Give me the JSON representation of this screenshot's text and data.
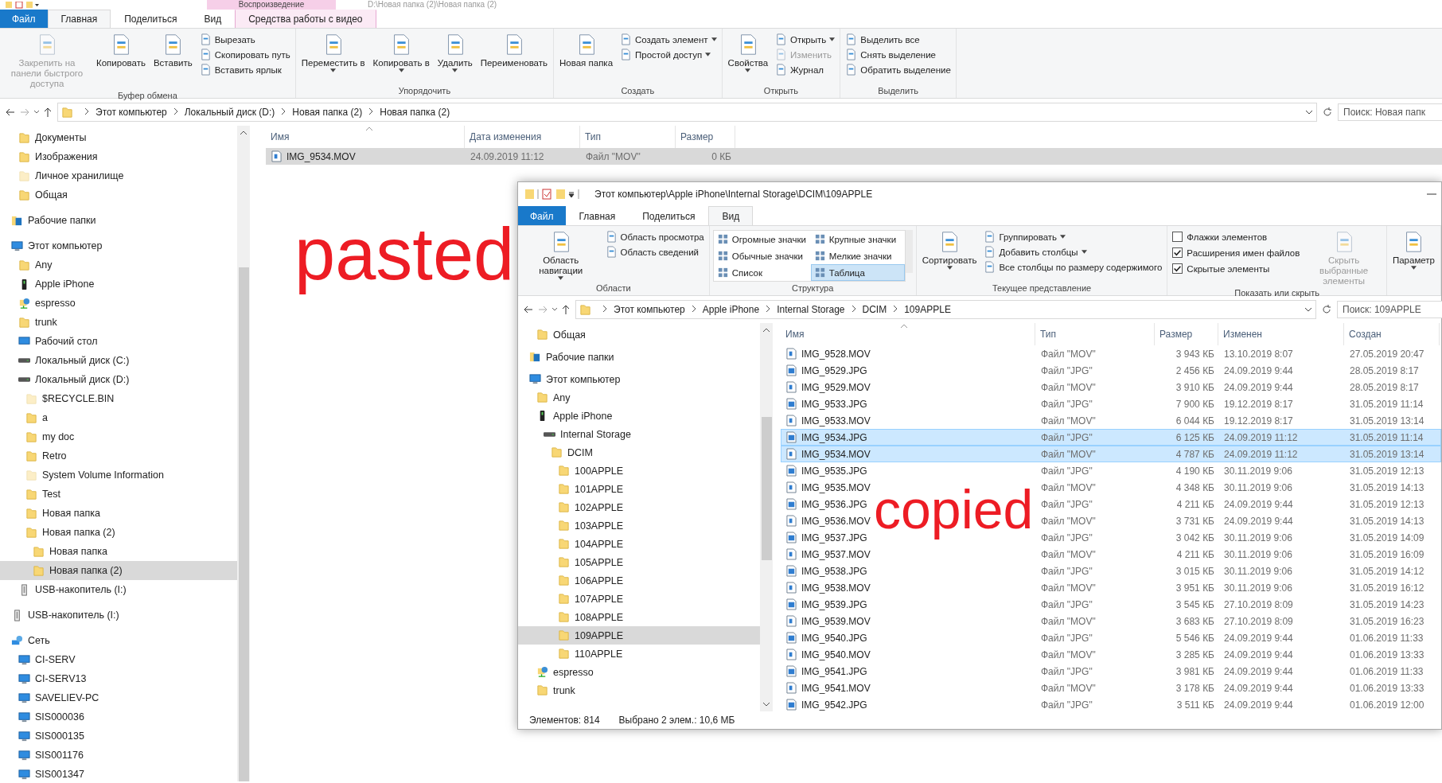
{
  "back_window": {
    "title": "D:\\Новая папка (2)\\Новая папка (2)",
    "context_group": "Воспроизведение",
    "tabs": [
      {
        "label": "Файл",
        "kind": "file",
        "selected": false
      },
      {
        "label": "Главная",
        "kind": "tab",
        "selected": true
      },
      {
        "label": "Поделиться",
        "kind": "tab",
        "selected": false
      },
      {
        "label": "Вид",
        "kind": "tab",
        "selected": false
      },
      {
        "label": "Средства работы с видео",
        "kind": "context",
        "selected": false
      }
    ],
    "ribbon": [
      {
        "label": "Буфер обмена",
        "items": [
          {
            "kind": "large",
            "label": "Закрепить на панели быстрого доступа",
            "dropdown": false,
            "disabled": true
          },
          {
            "kind": "large",
            "label": "Копировать",
            "dropdown": false,
            "disabled": false
          },
          {
            "kind": "large",
            "label": "Вставить",
            "dropdown": false,
            "disabled": false
          },
          {
            "kind": "small",
            "label": "Вырезать",
            "dropdown": false,
            "disabled": false
          },
          {
            "kind": "small",
            "label": "Скопировать путь",
            "dropdown": false,
            "disabled": false
          },
          {
            "kind": "small",
            "label": "Вставить ярлык",
            "dropdown": false,
            "disabled": false
          }
        ]
      },
      {
        "label": "Упорядочить",
        "items": [
          {
            "kind": "large",
            "label": "Переместить в",
            "dropdown": true,
            "disabled": false
          },
          {
            "kind": "large",
            "label": "Копировать в",
            "dropdown": true,
            "disabled": false
          },
          {
            "kind": "large",
            "label": "Удалить",
            "dropdown": true,
            "disabled": false
          },
          {
            "kind": "large",
            "label": "Переименовать",
            "dropdown": false,
            "disabled": false
          }
        ]
      },
      {
        "label": "Создать",
        "items": [
          {
            "kind": "large",
            "label": "Новая папка",
            "dropdown": false,
            "disabled": false
          },
          {
            "kind": "small",
            "label": "Создать элемент",
            "dropdown": true,
            "disabled": false
          },
          {
            "kind": "small",
            "label": "Простой доступ",
            "dropdown": true,
            "disabled": false
          }
        ]
      },
      {
        "label": "Открыть",
        "items": [
          {
            "kind": "large",
            "label": "Свойства",
            "dropdown": true,
            "disabled": false
          },
          {
            "kind": "small",
            "label": "Открыть",
            "dropdown": true,
            "disabled": false
          },
          {
            "kind": "small",
            "label": "Изменить",
            "dropdown": false,
            "disabled": true
          },
          {
            "kind": "small",
            "label": "Журнал",
            "dropdown": false,
            "disabled": false
          }
        ]
      },
      {
        "label": "Выделить",
        "items": [
          {
            "kind": "small",
            "label": "Выделить все",
            "dropdown": false,
            "disabled": false
          },
          {
            "kind": "small",
            "label": "Снять выделение",
            "dropdown": false,
            "disabled": false
          },
          {
            "kind": "small",
            "label": "Обратить выделение",
            "dropdown": false,
            "disabled": false
          }
        ]
      }
    ],
    "address": [
      "Этот компьютер",
      "Локальный диск (D:)",
      "Новая папка (2)",
      "Новая папка (2)"
    ],
    "search": {
      "placeholder": "Поиск: Новая папк"
    },
    "nav": [
      {
        "children": [
          {
            "label": "Документы",
            "kind": "folder",
            "hidden": false,
            "selected": false
          },
          {
            "label": "Изображения",
            "kind": "folder",
            "hidden": false,
            "selected": false
          },
          {
            "label": "Личное хранилище",
            "kind": "shortcut",
            "hidden": true,
            "selected": false
          },
          {
            "label": "Общая",
            "kind": "folder",
            "hidden": false,
            "selected": false
          }
        ]
      },
      {
        "label": "Рабочие папки",
        "kind": "workfolders",
        "selected": false
      },
      {
        "label": "Этот компьютер",
        "kind": "computer",
        "selected": false,
        "children": [
          {
            "label": "Any",
            "kind": "folder",
            "selected": false
          },
          {
            "label": "Apple iPhone",
            "kind": "phone",
            "selected": false
          },
          {
            "label": "espresso",
            "kind": "netshare",
            "selected": false
          },
          {
            "label": "trunk",
            "kind": "folder",
            "selected": false
          },
          {
            "label": "Рабочий стол",
            "kind": "desktop",
            "selected": false
          },
          {
            "label": "Локальный диск (C:)",
            "kind": "drive",
            "selected": false
          },
          {
            "label": "Локальный диск (D:)",
            "kind": "drive",
            "selected": false,
            "children": [
              {
                "label": "$RECYCLE.BIN",
                "kind": "folder",
                "hidden": true,
                "selected": false
              },
              {
                "label": "a",
                "kind": "folder",
                "hidden": false,
                "selected": false
              },
              {
                "label": "my doc",
                "kind": "folder",
                "hidden": false,
                "selected": false
              },
              {
                "label": "Retro",
                "kind": "folder",
                "hidden": false,
                "selected": false
              },
              {
                "label": "System Volume Information",
                "kind": "folder",
                "hidden": true,
                "selected": false
              },
              {
                "label": "Test",
                "kind": "folder",
                "hidden": false,
                "selected": false
              },
              {
                "label": "Новая папка",
                "kind": "folder",
                "hidden": false,
                "selected": false
              },
              {
                "label": "Новая папка (2)",
                "kind": "folder",
                "hidden": false,
                "selected": false,
                "children": [
                  {
                    "label": "Новая папка",
                    "kind": "folder",
                    "selected": false
                  },
                  {
                    "label": "Новая папка (2)",
                    "kind": "folder",
                    "selected": true
                  }
                ]
              }
            ]
          },
          {
            "label": "USB-накопитель (I:)",
            "kind": "usb",
            "selected": false
          }
        ]
      },
      {
        "label": "USB-накопитель (I:)",
        "kind": "usb",
        "selected": false
      },
      {
        "label": "Сеть",
        "kind": "network",
        "selected": false,
        "children": [
          {
            "label": "CI-SERV",
            "kind": "computer",
            "selected": false
          },
          {
            "label": "CI-SERV13",
            "kind": "computer",
            "selected": false
          },
          {
            "label": "SAVELIEV-PC",
            "kind": "computer",
            "selected": false
          },
          {
            "label": "SIS000036",
            "kind": "computer",
            "selected": false
          },
          {
            "label": "SIS000135",
            "kind": "computer",
            "selected": false
          },
          {
            "label": "SIS001176",
            "kind": "computer",
            "selected": false
          },
          {
            "label": "SIS001347",
            "kind": "computer",
            "selected": false
          }
        ]
      }
    ],
    "columns": [
      "Имя",
      "Дата изменения",
      "Тип",
      "Размер"
    ],
    "rows": [
      {
        "kind": "video",
        "cells": [
          "IMG_9534.MOV",
          "24.09.2019 11:12",
          "Файл \"MOV\"",
          "0 КБ"
        ],
        "selected": true
      }
    ]
  },
  "front_window": {
    "title": "Этот компьютер\\Apple iPhone\\Internal Storage\\DCIM\\109APPLE",
    "tabs": [
      {
        "label": "Файл",
        "kind": "file",
        "selected": false
      },
      {
        "label": "Главная",
        "kind": "tab",
        "selected": false
      },
      {
        "label": "Поделиться",
        "kind": "tab",
        "selected": false
      },
      {
        "label": "Вид",
        "kind": "tab",
        "selected": true
      }
    ],
    "ribbon": [
      {
        "label": "Области",
        "items": [
          {
            "kind": "large",
            "label": "Область навигации",
            "dropdown": true,
            "disabled": false
          },
          {
            "kind": "small",
            "label": "Область просмотра",
            "dropdown": false,
            "disabled": false
          },
          {
            "kind": "small",
            "label": "Область сведений",
            "dropdown": false,
            "disabled": false
          }
        ]
      },
      {
        "label": "Структура",
        "items": [
          {
            "kind": "gallery",
            "options": [
              {
                "label": "Огромные значки",
                "selected": false
              },
              {
                "label": "Крупные значки",
                "selected": false
              },
              {
                "label": "Обычные значки",
                "selected": false
              },
              {
                "label": "Мелкие значки",
                "selected": false
              },
              {
                "label": "Список",
                "selected": false
              },
              {
                "label": "Таблица",
                "selected": true
              }
            ]
          }
        ]
      },
      {
        "label": "Текущее представление",
        "items": [
          {
            "kind": "large",
            "label": "Сортировать",
            "dropdown": true,
            "disabled": false
          },
          {
            "kind": "small",
            "label": "Группировать",
            "dropdown": true,
            "disabled": false
          },
          {
            "kind": "small",
            "label": "Добавить столбцы",
            "dropdown": true,
            "disabled": false
          },
          {
            "kind": "small",
            "label": "Все столбцы по размеру содержимого",
            "dropdown": false,
            "disabled": false
          }
        ]
      },
      {
        "label": "Показать или скрыть",
        "items": [
          {
            "kind": "checkbox",
            "label": "Флажки элементов",
            "checked": false
          },
          {
            "kind": "checkbox",
            "label": "Расширения имен файлов",
            "checked": true
          },
          {
            "kind": "checkbox",
            "label": "Скрытые элементы",
            "checked": true
          },
          {
            "kind": "large",
            "label": "Скрыть выбранные элементы",
            "dropdown": false,
            "disabled": true
          }
        ]
      },
      {
        "items": [
          {
            "kind": "large",
            "label": "Параметр",
            "dropdown": true,
            "disabled": false
          }
        ]
      }
    ],
    "address": [
      "Этот компьютер",
      "Apple iPhone",
      "Internal Storage",
      "DCIM",
      "109APPLE"
    ],
    "search": {
      "placeholder": "Поиск: 109APPLE"
    },
    "nav": [
      {
        "children": [
          {
            "label": "Общая",
            "kind": "folder",
            "selected": false
          }
        ]
      },
      {
        "label": "Рабочие папки",
        "kind": "workfolders",
        "selected": false
      },
      {
        "label": "Этот компьютер",
        "kind": "computer",
        "selected": false,
        "children": [
          {
            "label": "Any",
            "kind": "folder",
            "selected": false
          },
          {
            "label": "Apple iPhone",
            "kind": "phone",
            "selected": false,
            "children": [
              {
                "label": "Internal Storage",
                "kind": "drive",
                "selected": false,
                "children": [
                  {
                    "label": "DCIM",
                    "kind": "folder",
                    "selected": false,
                    "children": [
                      {
                        "label": "100APPLE",
                        "kind": "folder",
                        "selected": false
                      },
                      {
                        "label": "101APPLE",
                        "kind": "folder",
                        "selected": false
                      },
                      {
                        "label": "102APPLE",
                        "kind": "folder",
                        "selected": false
                      },
                      {
                        "label": "103APPLE",
                        "kind": "folder",
                        "selected": false
                      },
                      {
                        "label": "104APPLE",
                        "kind": "folder",
                        "selected": false
                      },
                      {
                        "label": "105APPLE",
                        "kind": "folder",
                        "selected": false
                      },
                      {
                        "label": "106APPLE",
                        "kind": "folder",
                        "selected": false
                      },
                      {
                        "label": "107APPLE",
                        "kind": "folder",
                        "selected": false
                      },
                      {
                        "label": "108APPLE",
                        "kind": "folder",
                        "selected": false
                      },
                      {
                        "label": "109APPLE",
                        "kind": "folder",
                        "selected": true
                      },
                      {
                        "label": "110APPLE",
                        "kind": "folder",
                        "selected": false
                      }
                    ]
                  }
                ]
              }
            ]
          },
          {
            "label": "espresso",
            "kind": "netshare",
            "selected": false
          },
          {
            "label": "trunk",
            "kind": "folder",
            "selected": false
          }
        ]
      }
    ],
    "columns": [
      "Имя",
      "Тип",
      "Размер",
      "Изменен",
      "Создан"
    ],
    "rows": [
      {
        "kind": "video",
        "cells": [
          "IMG_9528.MOV",
          "Файл \"MOV\"",
          "3 943 КБ",
          "13.10.2019 8:07",
          "27.05.2019 20:47"
        ],
        "selected": false
      },
      {
        "kind": "image",
        "cells": [
          "IMG_9529.JPG",
          "Файл \"JPG\"",
          "2 456 КБ",
          "24.09.2019 9:44",
          "28.05.2019 8:17"
        ],
        "selected": false
      },
      {
        "kind": "video",
        "cells": [
          "IMG_9529.MOV",
          "Файл \"MOV\"",
          "3 910 КБ",
          "24.09.2019 9:44",
          "28.05.2019 8:17"
        ],
        "selected": false
      },
      {
        "kind": "image",
        "cells": [
          "IMG_9533.JPG",
          "Файл \"JPG\"",
          "7 900 КБ",
          "19.12.2019 8:17",
          "31.05.2019 11:14"
        ],
        "selected": false
      },
      {
        "kind": "video",
        "cells": [
          "IMG_9533.MOV",
          "Файл \"MOV\"",
          "6 044 КБ",
          "19.12.2019 8:17",
          "31.05.2019 13:14"
        ],
        "selected": false
      },
      {
        "kind": "image",
        "cells": [
          "IMG_9534.JPG",
          "Файл \"JPG\"",
          "6 125 КБ",
          "24.09.2019 11:12",
          "31.05.2019 11:14"
        ],
        "selected": true
      },
      {
        "kind": "video",
        "cells": [
          "IMG_9534.MOV",
          "Файл \"MOV\"",
          "4 787 КБ",
          "24.09.2019 11:12",
          "31.05.2019 13:14"
        ],
        "selected": true
      },
      {
        "kind": "image",
        "cells": [
          "IMG_9535.JPG",
          "Файл \"JPG\"",
          "4 190 КБ",
          "30.11.2019 9:06",
          "31.05.2019 12:13"
        ],
        "selected": false
      },
      {
        "kind": "video",
        "cells": [
          "IMG_9535.MOV",
          "Файл \"MOV\"",
          "4 348 КБ",
          "30.11.2019 9:06",
          "31.05.2019 14:13"
        ],
        "selected": false
      },
      {
        "kind": "image",
        "cells": [
          "IMG_9536.JPG",
          "Файл \"JPG\"",
          "4 211 КБ",
          "24.09.2019 9:44",
          "31.05.2019 12:13"
        ],
        "selected": false
      },
      {
        "kind": "video",
        "cells": [
          "IMG_9536.MOV",
          "Файл \"MOV\"",
          "3 731 КБ",
          "24.09.2019 9:44",
          "31.05.2019 14:13"
        ],
        "selected": false
      },
      {
        "kind": "image",
        "cells": [
          "IMG_9537.JPG",
          "Файл \"JPG\"",
          "3 042 КБ",
          "30.11.2019 9:06",
          "31.05.2019 14:09"
        ],
        "selected": false
      },
      {
        "kind": "video",
        "cells": [
          "IMG_9537.MOV",
          "Файл \"MOV\"",
          "4 211 КБ",
          "30.11.2019 9:06",
          "31.05.2019 16:09"
        ],
        "selected": false
      },
      {
        "kind": "image",
        "cells": [
          "IMG_9538.JPG",
          "Файл \"JPG\"",
          "3 015 КБ",
          "30.11.2019 9:06",
          "31.05.2019 14:12"
        ],
        "selected": false
      },
      {
        "kind": "video",
        "cells": [
          "IMG_9538.MOV",
          "Файл \"MOV\"",
          "3 951 КБ",
          "30.11.2019 9:06",
          "31.05.2019 16:12"
        ],
        "selected": false
      },
      {
        "kind": "image",
        "cells": [
          "IMG_9539.JPG",
          "Файл \"JPG\"",
          "3 545 КБ",
          "27.10.2019 8:09",
          "31.05.2019 14:23"
        ],
        "selected": false
      },
      {
        "kind": "video",
        "cells": [
          "IMG_9539.MOV",
          "Файл \"MOV\"",
          "3 683 КБ",
          "27.10.2019 8:09",
          "31.05.2019 16:23"
        ],
        "selected": false
      },
      {
        "kind": "image",
        "cells": [
          "IMG_9540.JPG",
          "Файл \"JPG\"",
          "5 546 КБ",
          "24.09.2019 9:44",
          "01.06.2019 11:33"
        ],
        "selected": false
      },
      {
        "kind": "video",
        "cells": [
          "IMG_9540.MOV",
          "Файл \"MOV\"",
          "3 285 КБ",
          "24.09.2019 9:44",
          "01.06.2019 13:33"
        ],
        "selected": false
      },
      {
        "kind": "image",
        "cells": [
          "IMG_9541.JPG",
          "Файл \"JPG\"",
          "3 981 КБ",
          "24.09.2019 9:44",
          "01.06.2019 11:33"
        ],
        "selected": false
      },
      {
        "kind": "video",
        "cells": [
          "IMG_9541.MOV",
          "Файл \"MOV\"",
          "3 178 КБ",
          "24.09.2019 9:44",
          "01.06.2019 13:33"
        ],
        "selected": false
      },
      {
        "kind": "image",
        "cells": [
          "IMG_9542.JPG",
          "Файл \"JPG\"",
          "3 511 КБ",
          "24.09.2019 9:44",
          "01.06.2019 12:00"
        ],
        "selected": false
      }
    ],
    "status": [
      "Элементов: 814",
      "Выбрано 2 элем.: 10,6 МБ"
    ]
  },
  "annotations": [
    {
      "kind": "pasted",
      "text": "pasted"
    },
    {
      "kind": "copied",
      "text": "copied"
    }
  ]
}
